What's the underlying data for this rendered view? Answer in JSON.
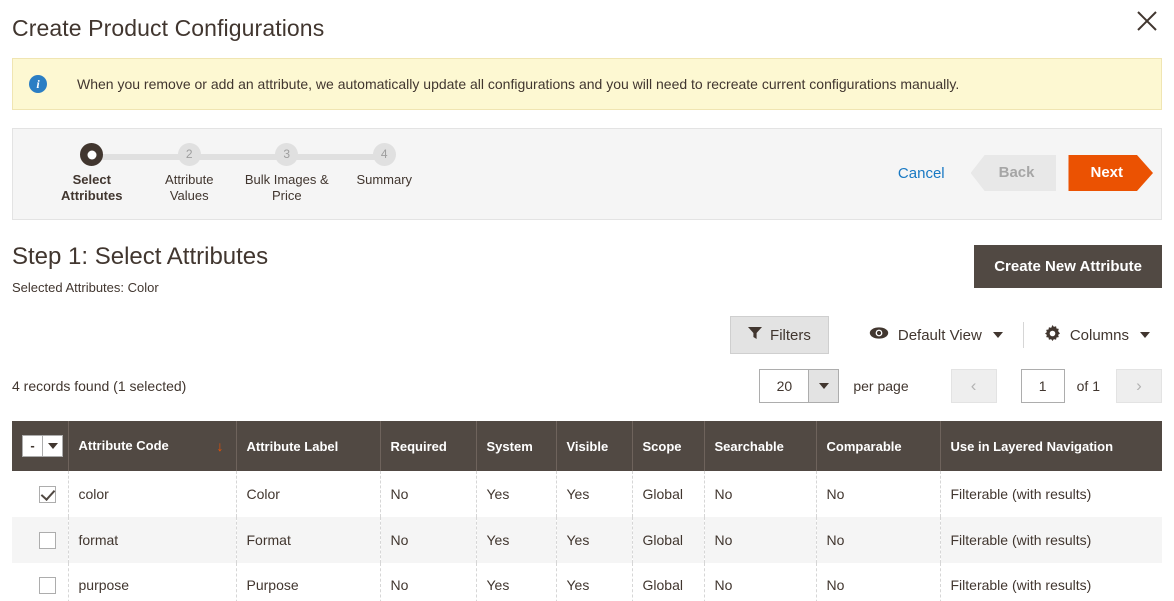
{
  "header": {
    "title": "Create Product Configurations",
    "close_icon": "close-icon"
  },
  "notice": {
    "icon": "info-icon",
    "message": "When you remove or add an attribute, we automatically update all configurations and you will need to recreate current configurations manually."
  },
  "wizard": {
    "steps": [
      {
        "number": "1",
        "label_line1": "Select",
        "label_line2": "Attributes",
        "active": true
      },
      {
        "number": "2",
        "label_line1": "Attribute",
        "label_line2": "Values",
        "active": false
      },
      {
        "number": "3",
        "label_line1": "Bulk Images &",
        "label_line2": "Price",
        "active": false
      },
      {
        "number": "4",
        "label_line1": "Summary",
        "label_line2": "",
        "active": false
      }
    ],
    "cancel_label": "Cancel",
    "back_label": "Back",
    "next_label": "Next",
    "next_color": "#eb5202"
  },
  "step_section": {
    "heading": "Step 1: Select Attributes",
    "selected_attributes": "Selected Attributes: Color",
    "create_attribute_label": "Create New Attribute"
  },
  "toolbar": {
    "filters_label": "Filters",
    "filters_icon": "funnel-icon",
    "view_label": "Default View",
    "view_icon": "eye-icon",
    "columns_label": "Columns",
    "columns_icon": "gear-icon"
  },
  "pager": {
    "records_found": "4 records found (1 selected)",
    "per_page_value": "20",
    "per_page_label": "per page",
    "current_page": "1",
    "of_total": "of 1",
    "prev_icon": "chevron-left-icon",
    "next_icon": "chevron-right-icon"
  },
  "grid": {
    "massaction_value": "-",
    "sort_column": "Attribute Code",
    "sort_direction_glyph": "↓",
    "columns": [
      "Attribute Code",
      "Attribute Label",
      "Required",
      "System",
      "Visible",
      "Scope",
      "Searchable",
      "Comparable",
      "Use in Layered Navigation"
    ],
    "rows": [
      {
        "selected": true,
        "attribute_code": "color",
        "attribute_label": "Color",
        "required": "No",
        "system": "Yes",
        "visible": "Yes",
        "scope": "Global",
        "searchable": "No",
        "comparable": "No",
        "layered_navigation": "Filterable (with results)"
      },
      {
        "selected": false,
        "attribute_code": "format",
        "attribute_label": "Format",
        "required": "No",
        "system": "Yes",
        "visible": "Yes",
        "scope": "Global",
        "searchable": "No",
        "comparable": "No",
        "layered_navigation": "Filterable (with results)"
      },
      {
        "selected": false,
        "attribute_code": "purpose",
        "attribute_label": "Purpose",
        "required": "No",
        "system": "Yes",
        "visible": "Yes",
        "scope": "Global",
        "searchable": "No",
        "comparable": "No",
        "layered_navigation": "Filterable (with results)"
      }
    ]
  }
}
